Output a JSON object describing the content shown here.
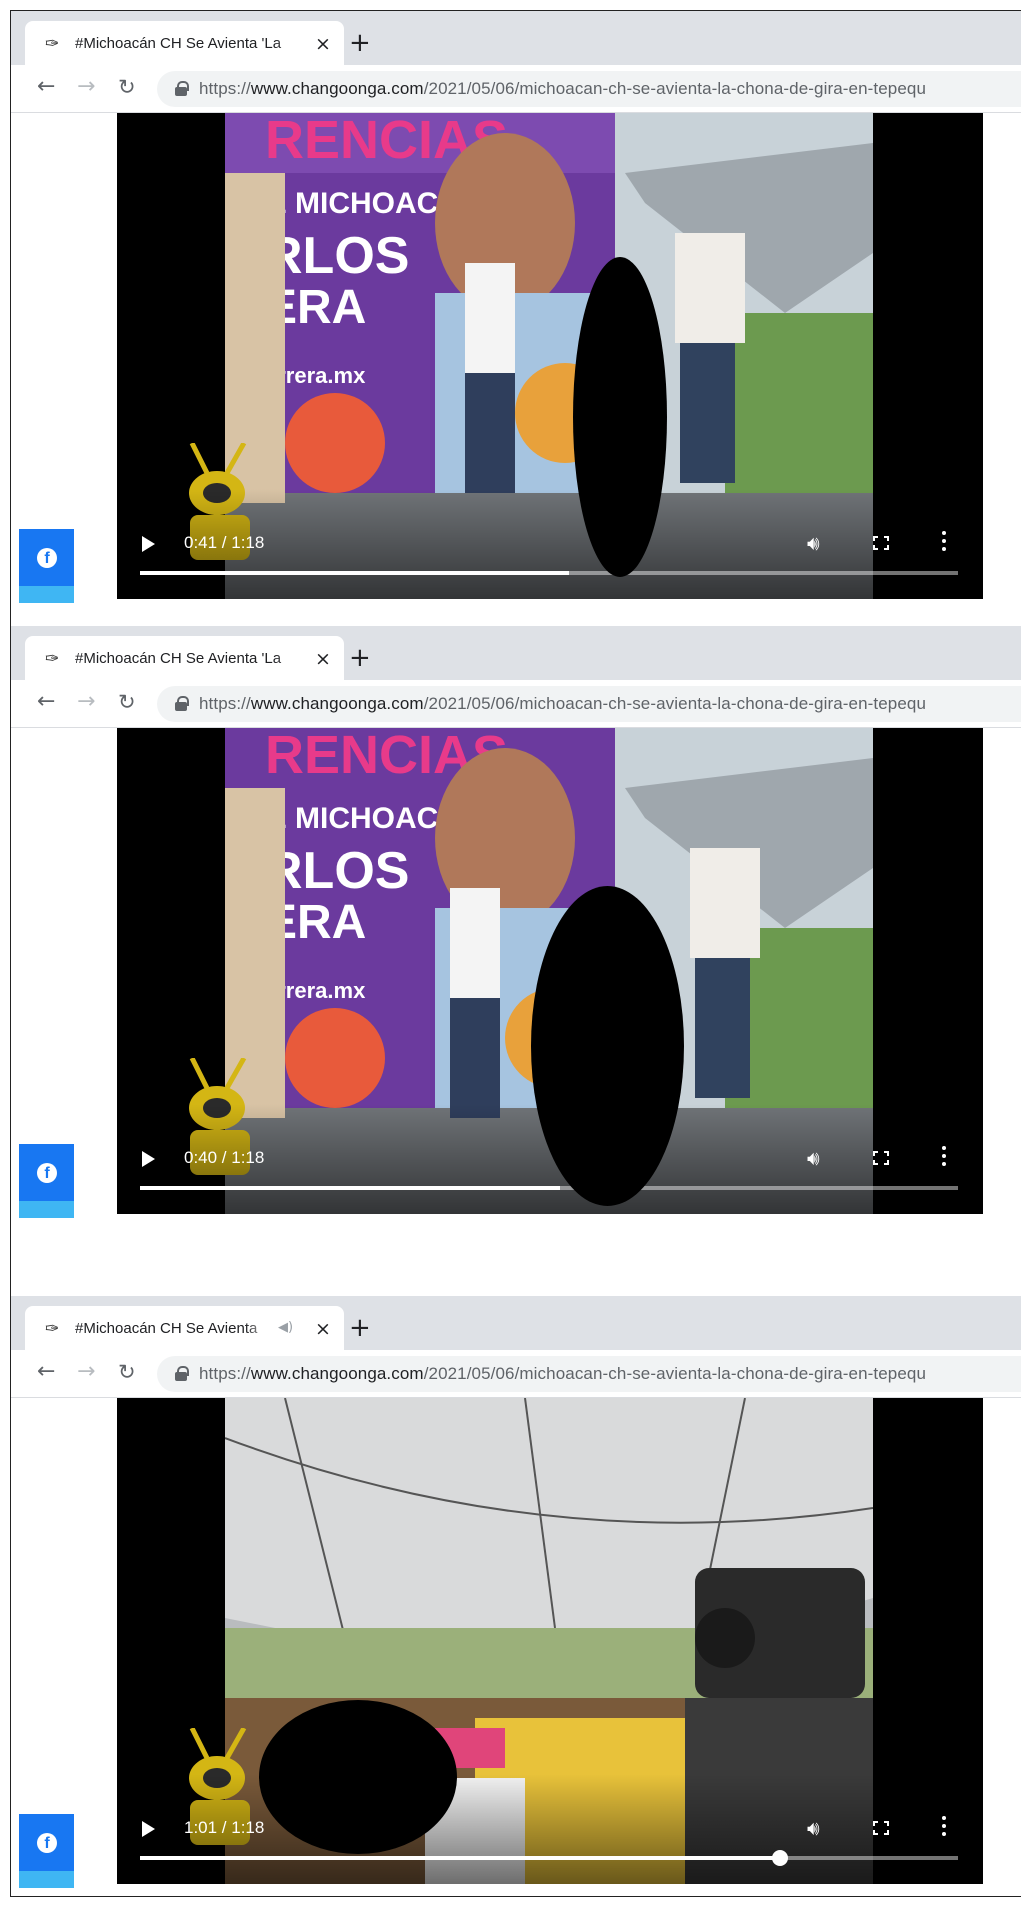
{
  "browser": {
    "tab_icon": "squirrel-icon",
    "new_tab_label": "+",
    "close_label": "×",
    "url_scheme": "https://",
    "url_domain": "www.changoonga.com",
    "url_path": "/2021/05/06/michoacan-ch-se-avienta-la-chona-de-gira-en-tepequ"
  },
  "panels": [
    {
      "tab_title": "#Michoacán CH Se Avienta 'La",
      "time": "0:41 / 1:18",
      "progress": 0.525,
      "audio_playing": false
    },
    {
      "tab_title": "#Michoacán CH Se Avienta 'La",
      "time": "0:40 / 1:18",
      "progress": 0.513,
      "audio_playing": false
    },
    {
      "tab_title": "#Michoacán CH Se Avienta",
      "time": "1:01 / 1:18",
      "progress": 0.782,
      "audio_playing": true
    }
  ],
  "share": {
    "icon": "facebook-icon",
    "letter": "f"
  },
  "icons": {
    "back": "back-arrow-icon",
    "forward": "forward-arrow-icon",
    "reload": "reload-icon",
    "lock": "lock-icon",
    "play": "play-icon",
    "volume": "volume-icon",
    "fullscreen": "fullscreen-icon",
    "more": "more-vertical-icon"
  },
  "colors": {
    "tab_strip": "#dee1e6",
    "facebook_blue": "#1877f2",
    "facebook_light": "#3fb6f3",
    "video_bg": "#000000"
  }
}
